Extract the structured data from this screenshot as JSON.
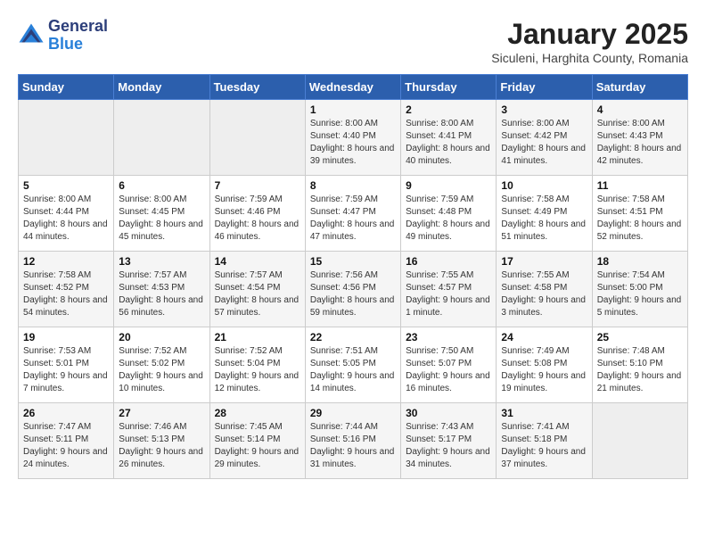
{
  "header": {
    "logo_general": "General",
    "logo_blue": "Blue",
    "title": "January 2025",
    "subtitle": "Siculeni, Harghita County, Romania"
  },
  "days_of_week": [
    "Sunday",
    "Monday",
    "Tuesday",
    "Wednesday",
    "Thursday",
    "Friday",
    "Saturday"
  ],
  "weeks": [
    [
      {
        "day": "",
        "empty": true
      },
      {
        "day": "",
        "empty": true
      },
      {
        "day": "",
        "empty": true
      },
      {
        "day": "1",
        "sunrise": "8:00 AM",
        "sunset": "4:40 PM",
        "daylight": "8 hours and 39 minutes."
      },
      {
        "day": "2",
        "sunrise": "8:00 AM",
        "sunset": "4:41 PM",
        "daylight": "8 hours and 40 minutes."
      },
      {
        "day": "3",
        "sunrise": "8:00 AM",
        "sunset": "4:42 PM",
        "daylight": "8 hours and 41 minutes."
      },
      {
        "day": "4",
        "sunrise": "8:00 AM",
        "sunset": "4:43 PM",
        "daylight": "8 hours and 42 minutes."
      }
    ],
    [
      {
        "day": "5",
        "sunrise": "8:00 AM",
        "sunset": "4:44 PM",
        "daylight": "8 hours and 44 minutes."
      },
      {
        "day": "6",
        "sunrise": "8:00 AM",
        "sunset": "4:45 PM",
        "daylight": "8 hours and 45 minutes."
      },
      {
        "day": "7",
        "sunrise": "7:59 AM",
        "sunset": "4:46 PM",
        "daylight": "8 hours and 46 minutes."
      },
      {
        "day": "8",
        "sunrise": "7:59 AM",
        "sunset": "4:47 PM",
        "daylight": "8 hours and 47 minutes."
      },
      {
        "day": "9",
        "sunrise": "7:59 AM",
        "sunset": "4:48 PM",
        "daylight": "8 hours and 49 minutes."
      },
      {
        "day": "10",
        "sunrise": "7:58 AM",
        "sunset": "4:49 PM",
        "daylight": "8 hours and 51 minutes."
      },
      {
        "day": "11",
        "sunrise": "7:58 AM",
        "sunset": "4:51 PM",
        "daylight": "8 hours and 52 minutes."
      }
    ],
    [
      {
        "day": "12",
        "sunrise": "7:58 AM",
        "sunset": "4:52 PM",
        "daylight": "8 hours and 54 minutes."
      },
      {
        "day": "13",
        "sunrise": "7:57 AM",
        "sunset": "4:53 PM",
        "daylight": "8 hours and 56 minutes."
      },
      {
        "day": "14",
        "sunrise": "7:57 AM",
        "sunset": "4:54 PM",
        "daylight": "8 hours and 57 minutes."
      },
      {
        "day": "15",
        "sunrise": "7:56 AM",
        "sunset": "4:56 PM",
        "daylight": "8 hours and 59 minutes."
      },
      {
        "day": "16",
        "sunrise": "7:55 AM",
        "sunset": "4:57 PM",
        "daylight": "9 hours and 1 minute."
      },
      {
        "day": "17",
        "sunrise": "7:55 AM",
        "sunset": "4:58 PM",
        "daylight": "9 hours and 3 minutes."
      },
      {
        "day": "18",
        "sunrise": "7:54 AM",
        "sunset": "5:00 PM",
        "daylight": "9 hours and 5 minutes."
      }
    ],
    [
      {
        "day": "19",
        "sunrise": "7:53 AM",
        "sunset": "5:01 PM",
        "daylight": "9 hours and 7 minutes."
      },
      {
        "day": "20",
        "sunrise": "7:52 AM",
        "sunset": "5:02 PM",
        "daylight": "9 hours and 10 minutes."
      },
      {
        "day": "21",
        "sunrise": "7:52 AM",
        "sunset": "5:04 PM",
        "daylight": "9 hours and 12 minutes."
      },
      {
        "day": "22",
        "sunrise": "7:51 AM",
        "sunset": "5:05 PM",
        "daylight": "9 hours and 14 minutes."
      },
      {
        "day": "23",
        "sunrise": "7:50 AM",
        "sunset": "5:07 PM",
        "daylight": "9 hours and 16 minutes."
      },
      {
        "day": "24",
        "sunrise": "7:49 AM",
        "sunset": "5:08 PM",
        "daylight": "9 hours and 19 minutes."
      },
      {
        "day": "25",
        "sunrise": "7:48 AM",
        "sunset": "5:10 PM",
        "daylight": "9 hours and 21 minutes."
      }
    ],
    [
      {
        "day": "26",
        "sunrise": "7:47 AM",
        "sunset": "5:11 PM",
        "daylight": "9 hours and 24 minutes."
      },
      {
        "day": "27",
        "sunrise": "7:46 AM",
        "sunset": "5:13 PM",
        "daylight": "9 hours and 26 minutes."
      },
      {
        "day": "28",
        "sunrise": "7:45 AM",
        "sunset": "5:14 PM",
        "daylight": "9 hours and 29 minutes."
      },
      {
        "day": "29",
        "sunrise": "7:44 AM",
        "sunset": "5:16 PM",
        "daylight": "9 hours and 31 minutes."
      },
      {
        "day": "30",
        "sunrise": "7:43 AM",
        "sunset": "5:17 PM",
        "daylight": "9 hours and 34 minutes."
      },
      {
        "day": "31",
        "sunrise": "7:41 AM",
        "sunset": "5:18 PM",
        "daylight": "9 hours and 37 minutes."
      },
      {
        "day": "",
        "empty": true
      }
    ]
  ]
}
